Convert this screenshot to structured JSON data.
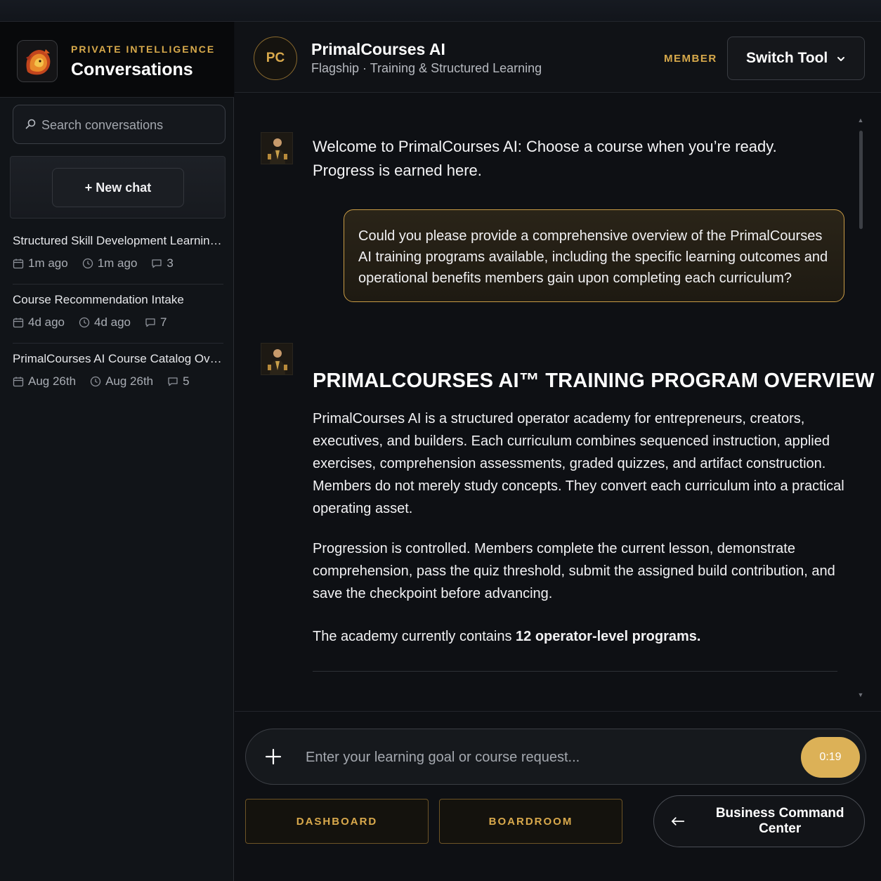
{
  "sidebar": {
    "brand_kicker": "PRIVATE INTELLIGENCE",
    "brand_title": "Conversations",
    "search_placeholder": "Search conversations",
    "new_chat_label": "+ New chat",
    "conversations": [
      {
        "title": "Structured Skill Development Learning ...",
        "created": "1m ago",
        "updated": "1m ago",
        "messages": "3"
      },
      {
        "title": "Course Recommendation Intake",
        "created": "4d ago",
        "updated": "4d ago",
        "messages": "7"
      },
      {
        "title": "PrimalCourses AI Course Catalog Overvi...",
        "created": "Aug 26th",
        "updated": "Aug 26th",
        "messages": "5"
      }
    ]
  },
  "header": {
    "avatar_initials": "PC",
    "tool_name": "PrimalCourses AI",
    "tool_subtitle": "Flagship · Training & Structured Learning",
    "member_badge": "MEMBER",
    "switch_label": "Switch Tool"
  },
  "chat": {
    "welcome_line1": "Welcome to PrimalCourses AI: Choose a course when you’re ready.",
    "welcome_line2": "Progress is earned here.",
    "user_message": "Could you please provide a comprehensive overview of the PrimalCourses AI training programs available, including the specific learning outcomes and operational benefits members gain upon completing each curriculum?",
    "overview_title": "PRIMALCOURSES AI™ TRAINING PROGRAM OVERVIEW",
    "para1": "PrimalCourses AI is a structured operator academy for entrepreneurs, creators, executives, and builders. Each curriculum combines sequenced instruction, applied exercises, comprehension assessments, graded quizzes, and artifact construction. Members do not merely study concepts. They convert each curriculum into a practical operating asset.",
    "para2": "Progression is controlled. Members complete the current lesson, demonstrate comprehension, pass the quiz threshold, submit the assigned build contribution, and save the checkpoint before advancing.",
    "para3_prefix": "The academy currently contains ",
    "para3_bold": "12 operator-level programs."
  },
  "composer": {
    "placeholder": "Enter your learning goal or course request...",
    "timer": "0:19"
  },
  "footer": {
    "dashboard_label": "DASHBOARD",
    "boardroom_label": "BOARDROOM",
    "bcc_label": "Business Command Center"
  },
  "colors": {
    "accent_gold": "#d7a94b",
    "background": "#0e1014"
  }
}
